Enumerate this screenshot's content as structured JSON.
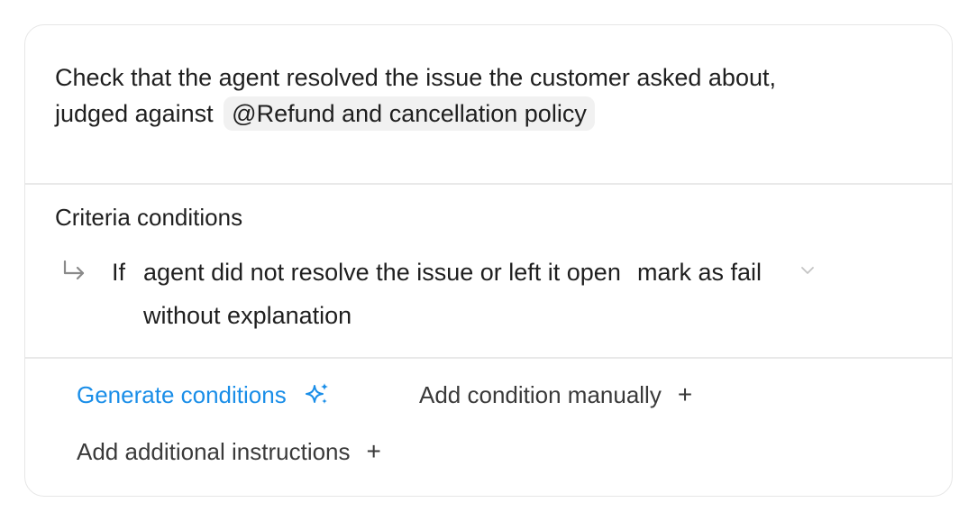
{
  "prompt": {
    "line1": "Check that the agent resolved the issue the customer asked about,",
    "line2": "judged against",
    "mention": "@Refund and cancellation policy"
  },
  "criteria": {
    "title": "Criteria conditions",
    "condition": {
      "if_label": "If",
      "text": "agent did not resolve the issue or left it open without explanation",
      "action": "mark as fail"
    }
  },
  "actions": {
    "generate": "Generate conditions",
    "add_manual": "Add condition manually",
    "add_instructions": "Add additional instructions",
    "plus": "+"
  },
  "colors": {
    "accent": "#1a8ee8",
    "border": "#e6e6e6",
    "chip_bg": "#f1f1f1"
  }
}
